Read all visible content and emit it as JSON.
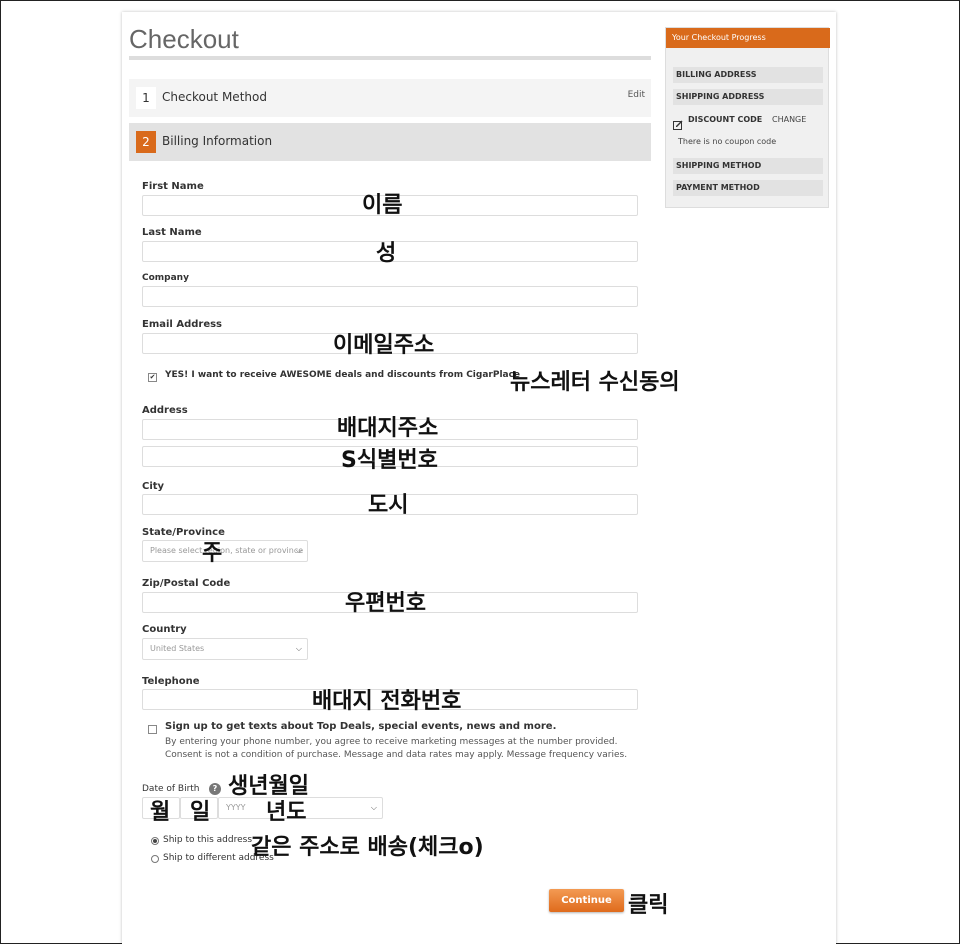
{
  "header": {
    "title": "Checkout"
  },
  "steps": [
    {
      "number": "1",
      "label": "Checkout Method",
      "action": "Edit"
    },
    {
      "number": "2",
      "label": "Billing Information"
    }
  ],
  "form": {
    "first_name": {
      "label": "First Name",
      "value": ""
    },
    "last_name": {
      "label": "Last Name",
      "value": ""
    },
    "company": {
      "label": "Company",
      "value": ""
    },
    "email": {
      "label": "Email Address",
      "value": ""
    },
    "newsletter": {
      "label": "YES! I want to receive AWESOME deals and discounts from CigarPlace",
      "checked": true
    },
    "address": {
      "label": "Address",
      "line1": "",
      "line2": ""
    },
    "city": {
      "label": "City",
      "value": ""
    },
    "state": {
      "label": "State/Province",
      "placeholder": "Please select region, state or province"
    },
    "zip": {
      "label": "Zip/Postal Code",
      "value": ""
    },
    "country": {
      "label": "Country",
      "selected": "United States"
    },
    "telephone": {
      "label": "Telephone",
      "value": ""
    },
    "sms": {
      "label": "Sign up to get texts about Top Deals, special events, news and more.",
      "disclaimer": "By entering your phone number, you agree to receive marketing messages at the number provided. Consent is not a condition of purchase. Message and data rates may apply. Message frequency varies.",
      "checked": false
    },
    "dob": {
      "label": "Date of Birth",
      "help": "?",
      "year_placeholder": "YYYY"
    },
    "ship_options": [
      {
        "label": "Ship to this address",
        "selected": true
      },
      {
        "label": "Ship to different address",
        "selected": false
      }
    ],
    "continue_label": "Continue"
  },
  "sidebar": {
    "title": "Your Checkout Progress",
    "items": [
      "BILLING ADDRESS",
      "SHIPPING ADDRESS"
    ],
    "discount": {
      "label": "DISCOUNT CODE",
      "action": "CHANGE",
      "note": "There is no coupon code"
    },
    "items_after": [
      "SHIPPING METHOD",
      "PAYMENT METHOD"
    ]
  },
  "annotations": {
    "first_name": "이름",
    "last_name": "성",
    "email": "이메일주소",
    "newsletter": "뉴스레터 수신동의",
    "address1": "배대지주소",
    "address2": "S식별번호",
    "city": "도시",
    "state": "주",
    "zip": "우편번호",
    "telephone": "배대지 전화번호",
    "dob": "생년월일",
    "month": "월",
    "day": "일",
    "year": "년도",
    "ship": "같은 주소로 배송(체크o)",
    "click": "클릭"
  }
}
